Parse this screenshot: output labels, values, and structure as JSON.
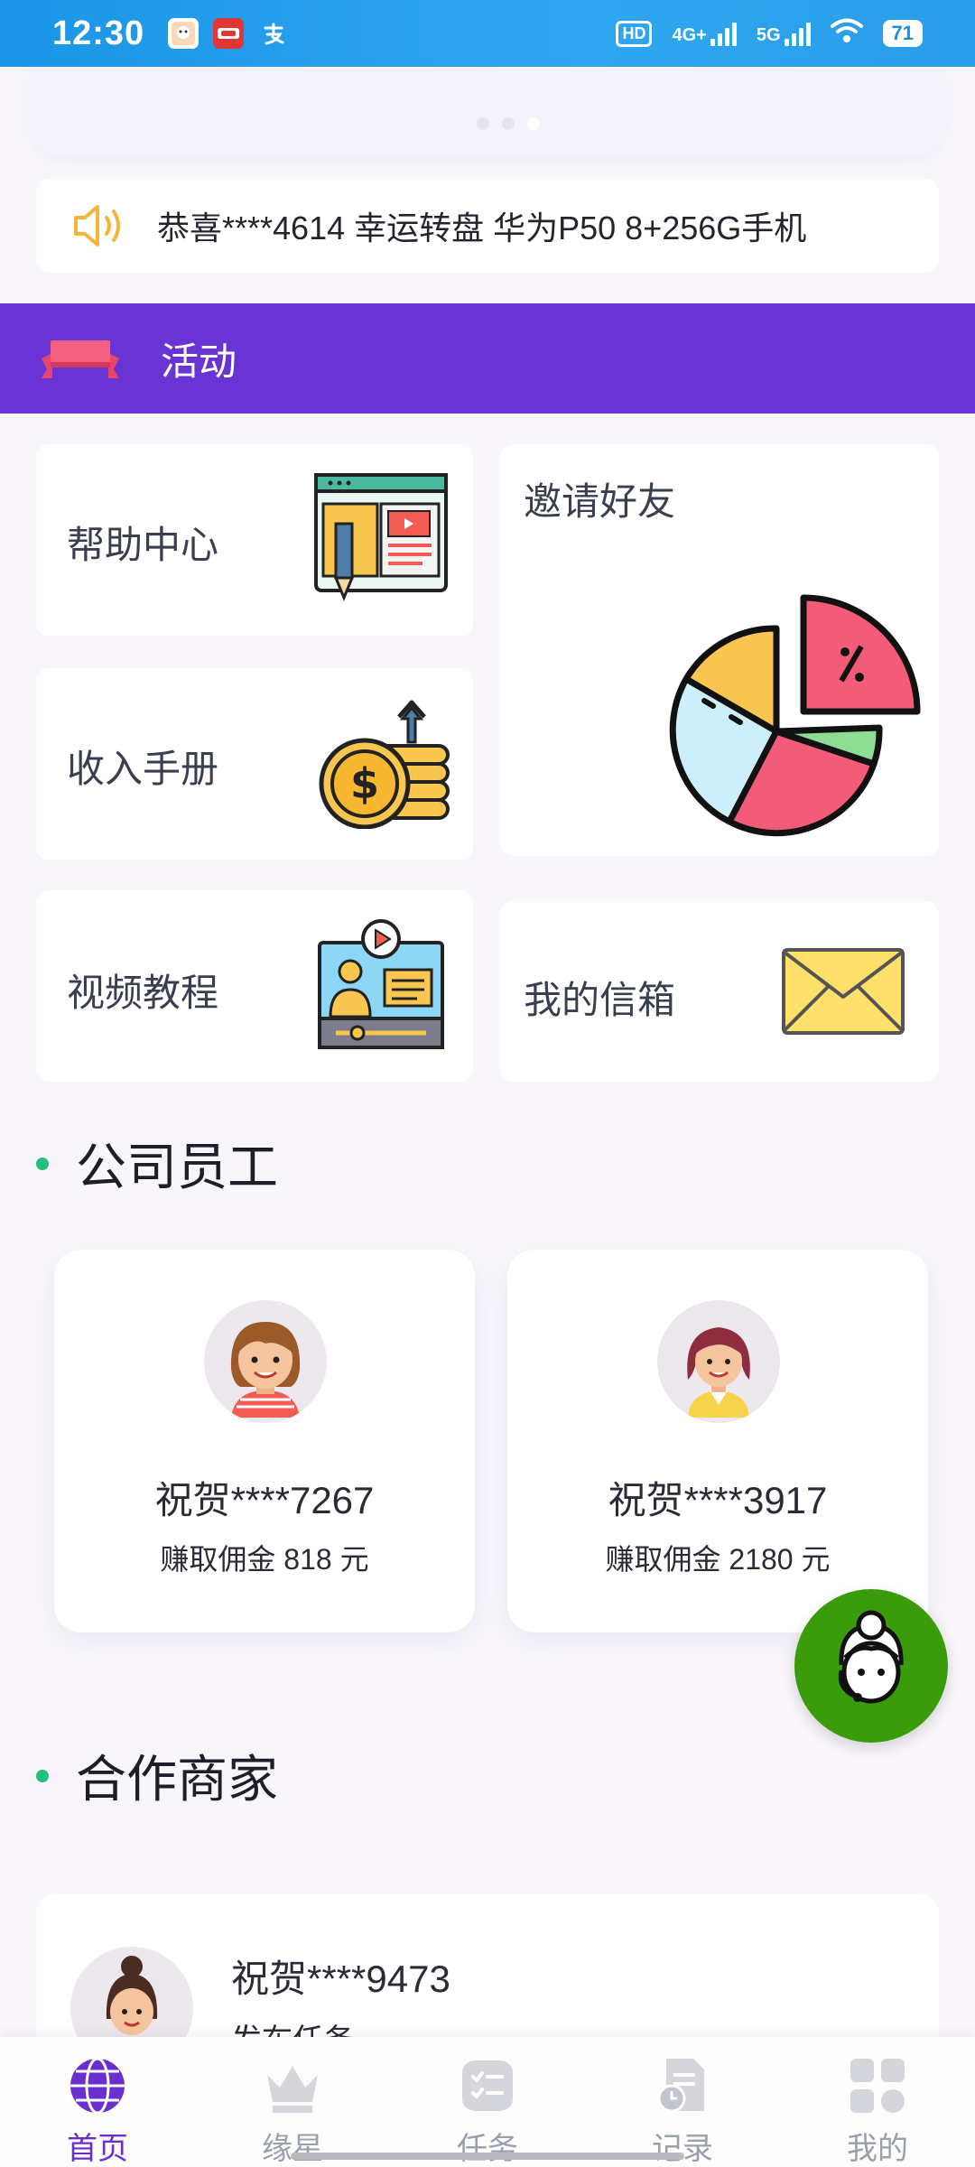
{
  "status_bar": {
    "time": "12:30",
    "app_icons": [
      "xiaohongshu-icon",
      "xiaohongshu-kids-icon",
      "alipay-icon"
    ],
    "hd_badge": "HD",
    "network_4g": "4G+",
    "network_5g": "5G",
    "battery": "71"
  },
  "banner": {
    "dots": 3,
    "active_dot": 3
  },
  "notice": {
    "text": "恭喜****4614 幸运转盘 华为P50 8+256G手机"
  },
  "activity": {
    "title": "活动",
    "tiles": {
      "help": "帮助中心",
      "invite": "邀请好友",
      "income": "收入手册",
      "video": "视频教程",
      "mailbox": "我的信箱"
    }
  },
  "employees": {
    "title": "公司员工",
    "cards": [
      {
        "name": "祝贺****7267",
        "earn": "赚取佣金 818 元"
      },
      {
        "name": "祝贺****3917",
        "earn": "赚取佣金 2180 元"
      }
    ]
  },
  "partners": {
    "title": "合作商家",
    "items": [
      {
        "name": "祝贺****9473",
        "sub": "发布任务"
      }
    ]
  },
  "nav": {
    "items": [
      {
        "label": "首页",
        "icon": "globe-icon",
        "active": true
      },
      {
        "label": "缘星",
        "icon": "crown-icon",
        "active": false
      },
      {
        "label": "任务",
        "icon": "task-list-icon",
        "active": false
      },
      {
        "label": "记录",
        "icon": "record-icon",
        "active": false
      },
      {
        "label": "我的",
        "icon": "grid-icon",
        "active": false
      }
    ]
  },
  "colors": {
    "status_bar": "#1b95e6",
    "activity_header": "#6a33d3",
    "section_dot": "#21c07c",
    "nav_active": "#6b2fd0",
    "fab": "#3a9c0b"
  }
}
